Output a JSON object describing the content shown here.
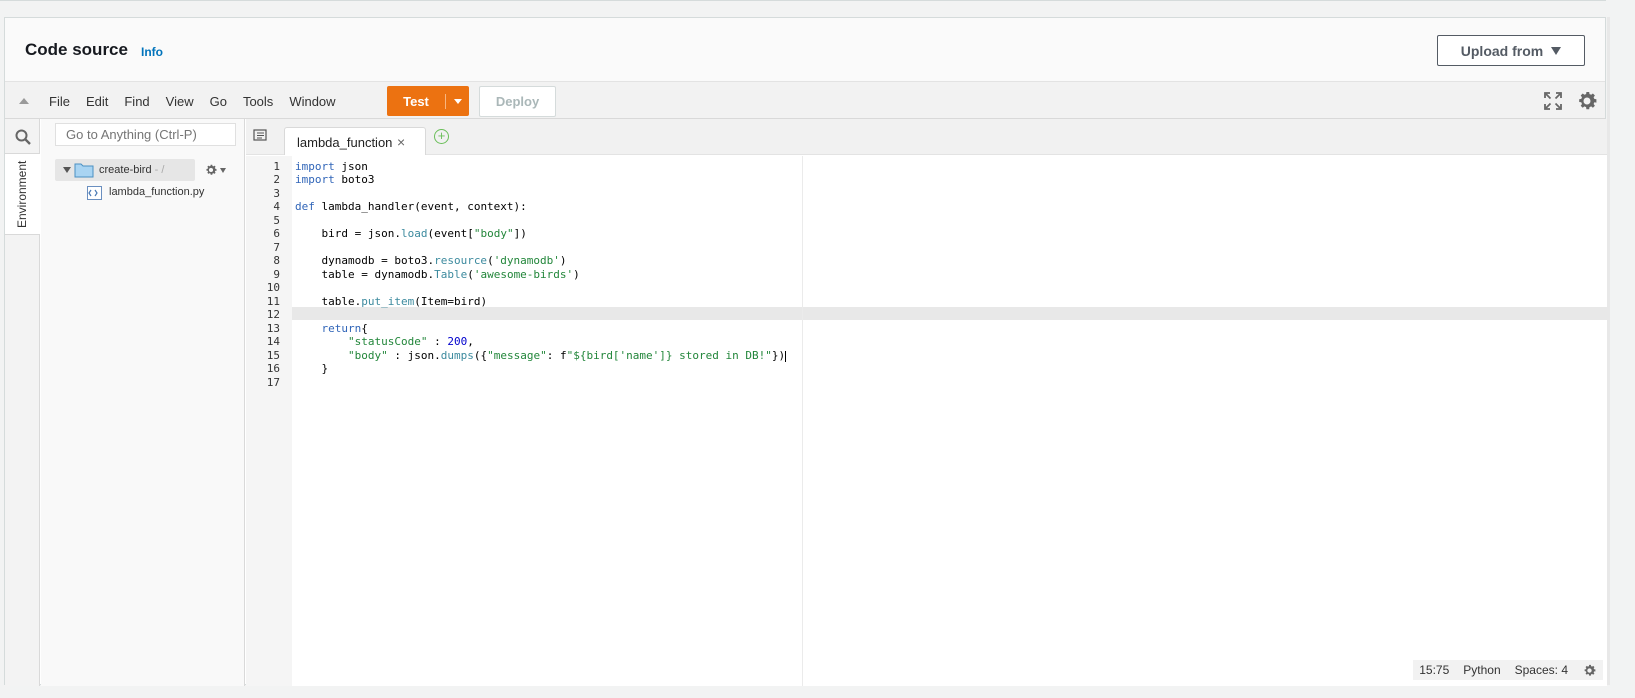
{
  "header": {
    "title": "Code source",
    "info_link": "Info",
    "upload_button": "Upload from"
  },
  "toolbar": {
    "menu_items": [
      "File",
      "Edit",
      "Find",
      "View",
      "Go",
      "Tools",
      "Window"
    ],
    "test_label": "Test",
    "deploy_label": "Deploy"
  },
  "sidebar": {
    "environment_tab": "Environment",
    "goto_placeholder": "Go to Anything (Ctrl-P)",
    "folder_name": "create-bird",
    "folder_suffix": " - /",
    "file_name": "lambda_function.py"
  },
  "editor": {
    "tab_name": "lambda_function",
    "tab_close": "×",
    "add_tab": "+",
    "line_numbers": [
      "1",
      "2",
      "3",
      "4",
      "5",
      "6",
      "7",
      "8",
      "9",
      "10",
      "11",
      "12",
      "13",
      "14",
      "15",
      "16",
      "17"
    ],
    "code_lines": [
      "import json",
      "import boto3",
      "",
      "def lambda_handler(event, context):",
      "",
      "    bird = json.load(event[\"body\"])",
      "",
      "    dynamodb = boto3.resource('dynamodb')",
      "    table = dynamodb.Table('awesome-birds')",
      "",
      "    table.put_item(Item=bird)",
      "",
      "    return{",
      "        \"statusCode\" : 200,",
      "        \"body\" : json.dumps({\"message\": f\"${bird['name']} stored in DB!\"})",
      "    }",
      ""
    ]
  },
  "status": {
    "position": "15:75",
    "language": "Python",
    "indent": "Spaces: 4"
  },
  "colors": {
    "accent": "#ec7211",
    "link": "#0073bb",
    "keyword": "#3065b8",
    "string": "#22863a"
  }
}
